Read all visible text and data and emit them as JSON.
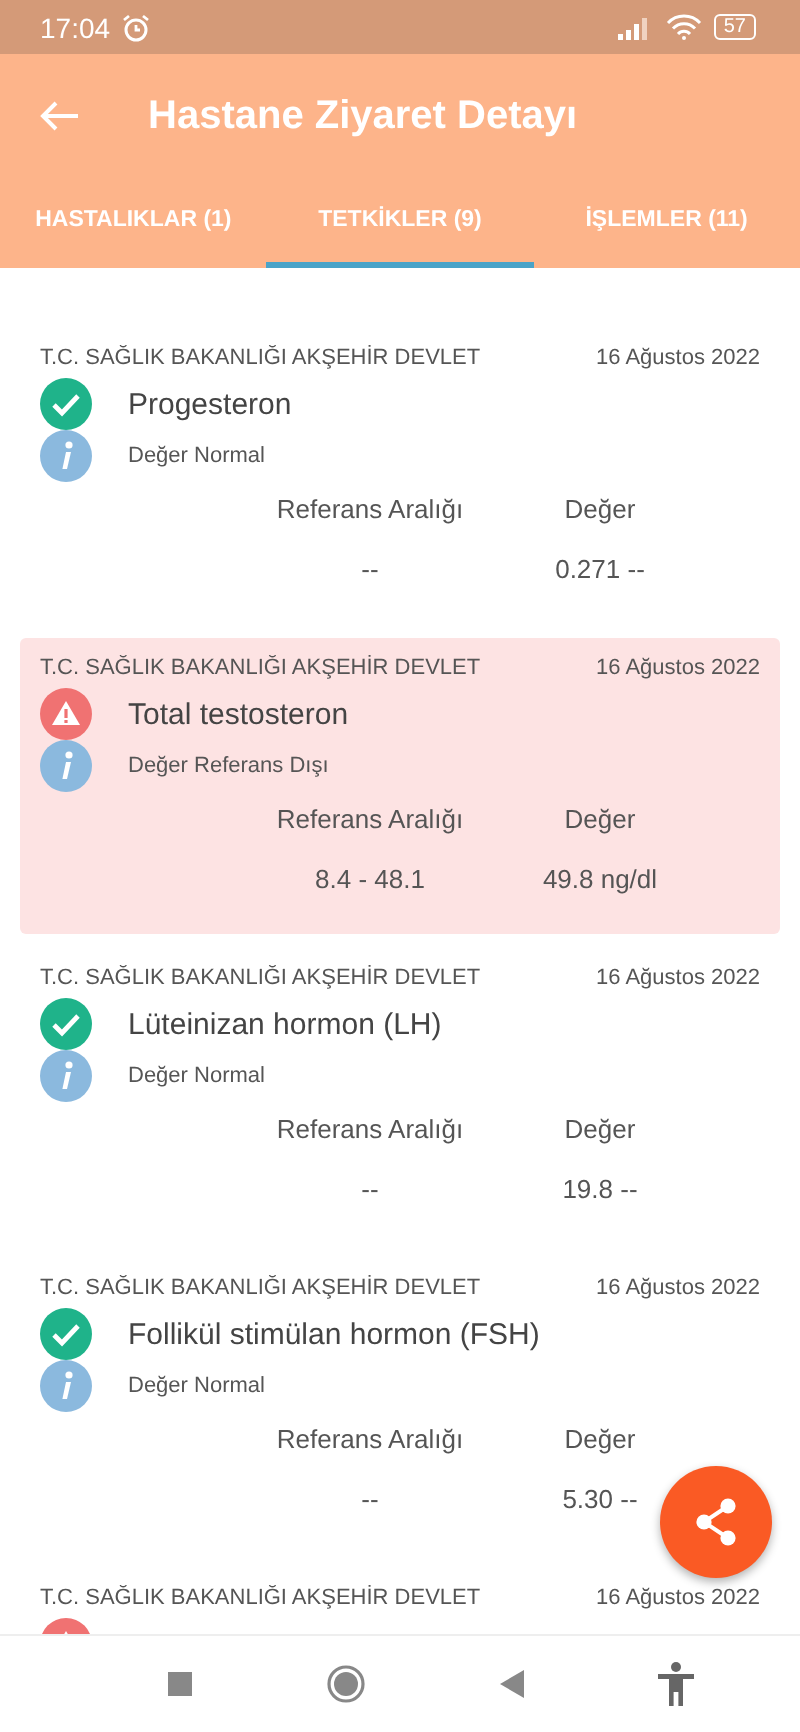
{
  "status_bar": {
    "time": "17:04",
    "battery": "57"
  },
  "app_bar": {
    "title": "Hastane Ziyaret Detayı"
  },
  "tabs": [
    {
      "label": "HASTALIKLAR (1)",
      "selected": false
    },
    {
      "label": "TETKİKLER (9)",
      "selected": true
    },
    {
      "label": "İŞLEMLER (11)",
      "selected": false
    }
  ],
  "tests": [
    {
      "institution": "T.C. SAĞLIK BAKANLIĞI AKŞEHİR DEVLET",
      "date": "16 Ağustos 2022",
      "name": "Progesteron",
      "kind": "normal",
      "status_text": "Değer Normal",
      "range_label": "Referans Aralığı",
      "value_label": "Değer",
      "range": "--",
      "value": "0.271 --"
    },
    {
      "institution": "T.C. SAĞLIK BAKANLIĞI AKŞEHİR DEVLET",
      "date": "16 Ağustos 2022",
      "name": "Total testosteron",
      "kind": "abnormal",
      "status_text": "Değer Referans Dışı",
      "range_label": "Referans Aralığı",
      "value_label": "Değer",
      "range": "8.4 - 48.1",
      "value": "49.8 ng/dl"
    },
    {
      "institution": "T.C. SAĞLIK BAKANLIĞI AKŞEHİR DEVLET",
      "date": "16 Ağustos 2022",
      "name": "Lüteinizan hormon (LH)",
      "kind": "normal",
      "status_text": "Değer Normal",
      "range_label": "Referans Aralığı",
      "value_label": "Değer",
      "range": "--",
      "value": "19.8 --"
    },
    {
      "institution": "T.C. SAĞLIK BAKANLIĞI AKŞEHİR DEVLET",
      "date": "16 Ağustos 2022",
      "name": "Follikül stimülan hormon (FSH)",
      "kind": "normal",
      "status_text": "Değer Normal",
      "range_label": "Referans Aralığı",
      "value_label": "Değer",
      "range": "--",
      "value": "5.30 --"
    },
    {
      "institution": "T.C. SAĞLIK BAKANLIĞI AKŞEHİR DEVLET",
      "date": "16 Ağustos 2022",
      "kind": "abnormal"
    }
  ]
}
